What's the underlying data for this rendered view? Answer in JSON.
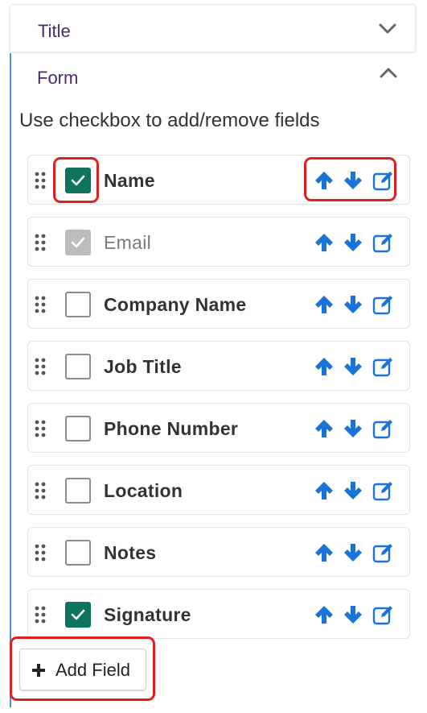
{
  "sections": {
    "title_label": "Title",
    "form_label": "Form"
  },
  "hint": "Use checkbox to add/remove fields",
  "fields": [
    {
      "label": "Name",
      "checked": true,
      "disabled": false
    },
    {
      "label": "Email",
      "checked": true,
      "disabled": true
    },
    {
      "label": "Company Name",
      "checked": false,
      "disabled": false
    },
    {
      "label": "Job Title",
      "checked": false,
      "disabled": false
    },
    {
      "label": "Phone Number",
      "checked": false,
      "disabled": false
    },
    {
      "label": "Location",
      "checked": false,
      "disabled": false
    },
    {
      "label": "Notes",
      "checked": false,
      "disabled": false
    },
    {
      "label": "Signature",
      "checked": true,
      "disabled": false
    }
  ],
  "icons": {
    "row_actions": [
      "arrow-up-icon",
      "arrow-down-icon",
      "edit-icon"
    ],
    "drag": "drag-handle-icon",
    "add": "plus-icon"
  },
  "add_field_label": "Add Field",
  "colors": {
    "accent_blue": "#1a73d9",
    "checkbox_green": "#0f7360",
    "highlight_red": "#e02020",
    "section_title": "#4a2a6e"
  }
}
